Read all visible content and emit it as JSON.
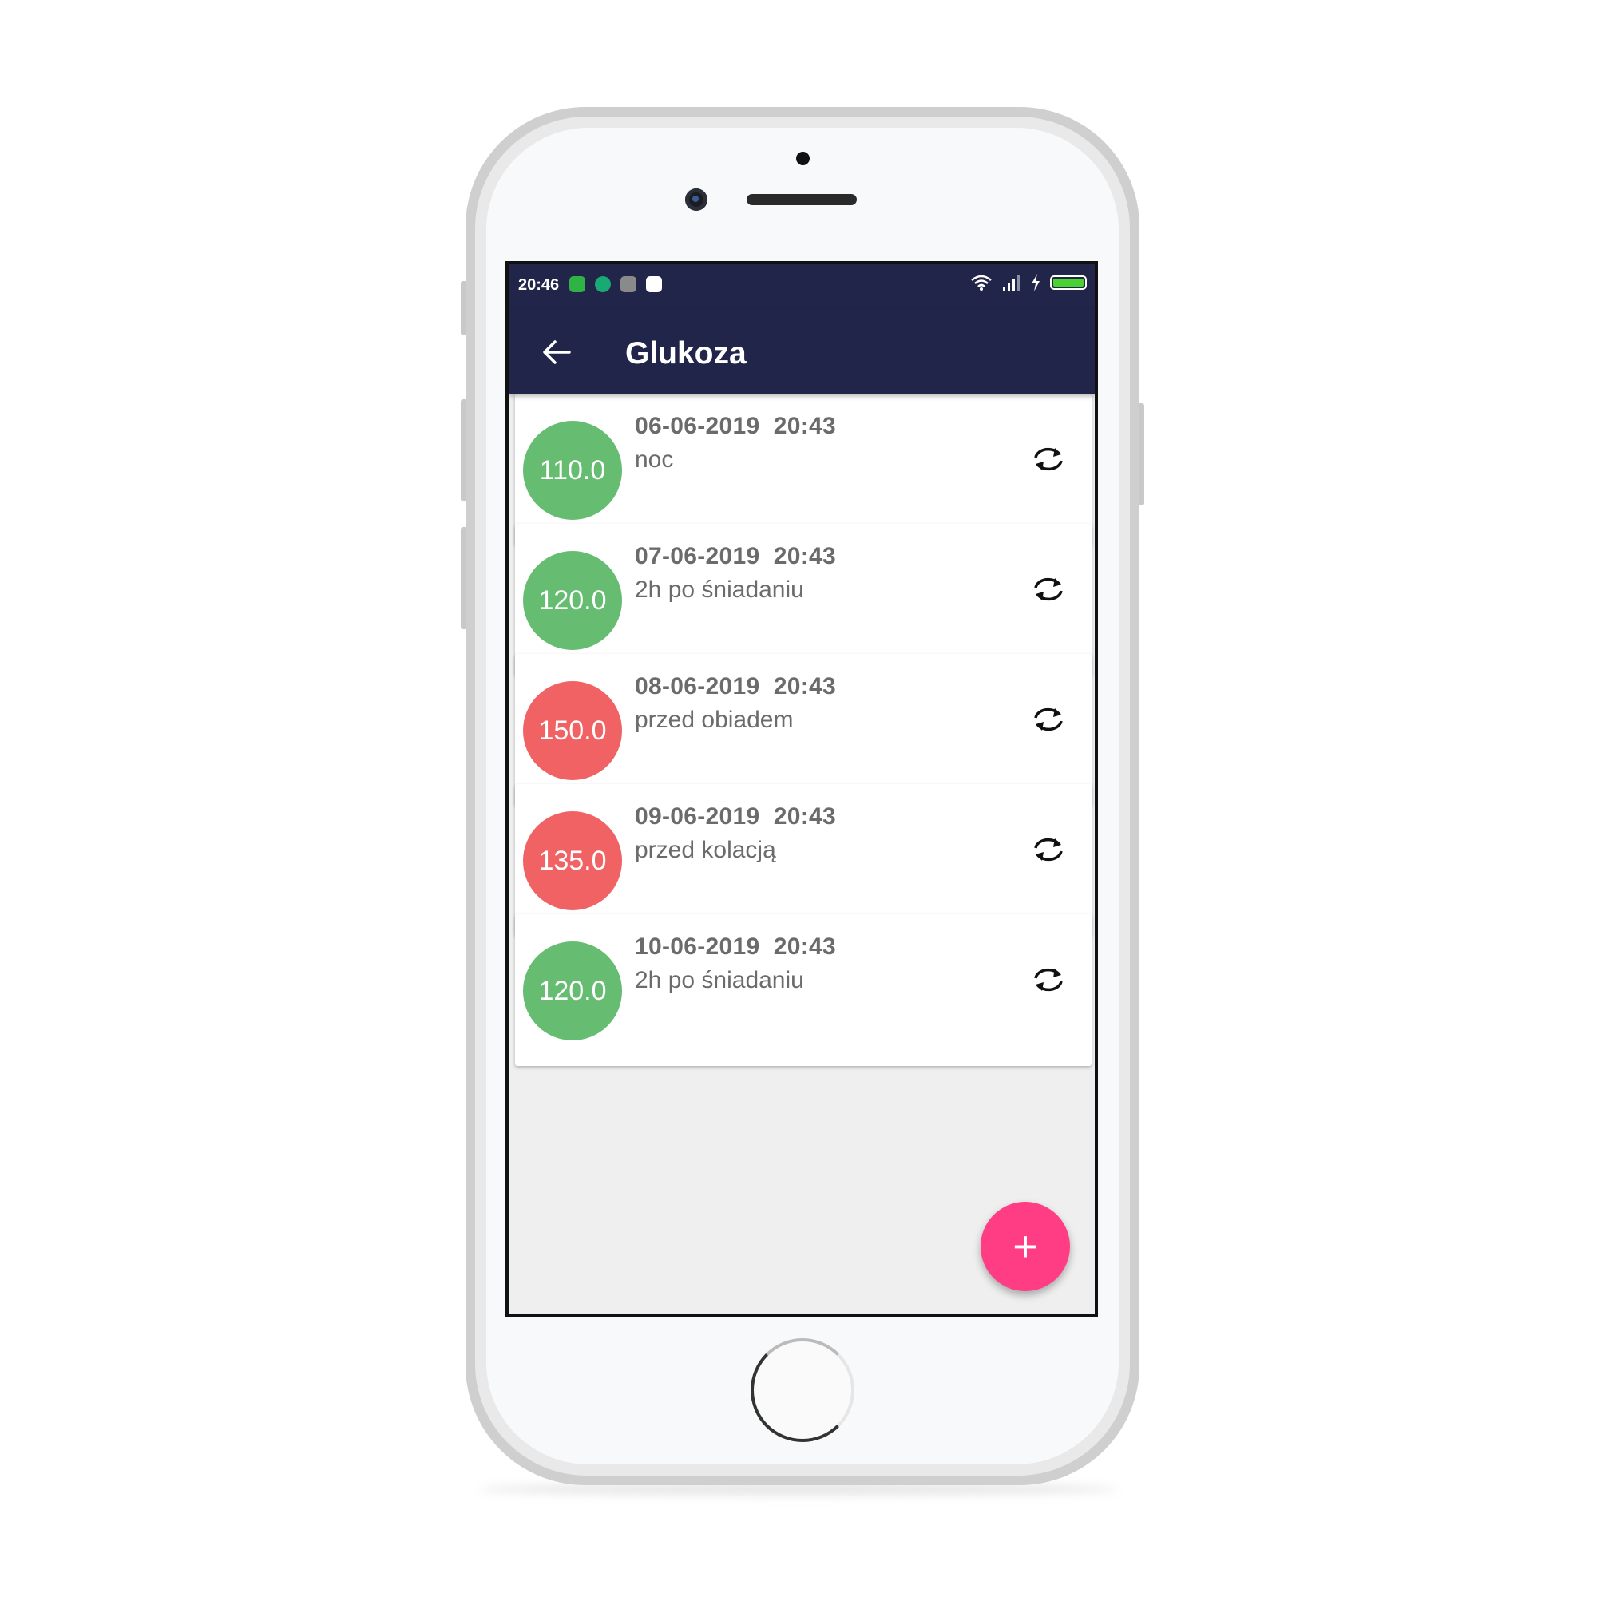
{
  "status_bar": {
    "time": "20:46",
    "notification_icons": [
      {
        "icon": "app-green-icon",
        "color": "#2fb344"
      },
      {
        "icon": "shield-icon",
        "color": "#19a974"
      },
      {
        "icon": "app-gray-icon",
        "color": "#8a8a8a"
      },
      {
        "icon": "app-white-icon",
        "color": "#ffffff"
      }
    ],
    "right_icons": [
      "wifi-icon",
      "signal-icon",
      "charging-icon",
      "battery-icon"
    ],
    "battery_level": 1.0
  },
  "app_bar": {
    "title": "Glukoza",
    "back_icon": "arrow-left-icon",
    "background_color": "#22254a"
  },
  "readings": [
    {
      "value": "110.0",
      "date": "06-06-2019  20:43",
      "label": "noc",
      "status_color": "#66bd72"
    },
    {
      "value": "120.0",
      "date": "07-06-2019  20:43",
      "label": "2h po śniadaniu",
      "status_color": "#66bd72"
    },
    {
      "value": "150.0",
      "date": "08-06-2019  20:43",
      "label": "przed obiadem",
      "status_color": "#f06264"
    },
    {
      "value": "135.0",
      "date": "09-06-2019  20:43",
      "label": "przed kolacją",
      "status_color": "#f06264"
    },
    {
      "value": "120.0",
      "date": "10-06-2019  20:43",
      "label": "2h po śniadaniu",
      "status_color": "#66bd72"
    }
  ],
  "fab": {
    "icon": "plus-icon",
    "symbol": "+",
    "color": "#ff3d84"
  }
}
